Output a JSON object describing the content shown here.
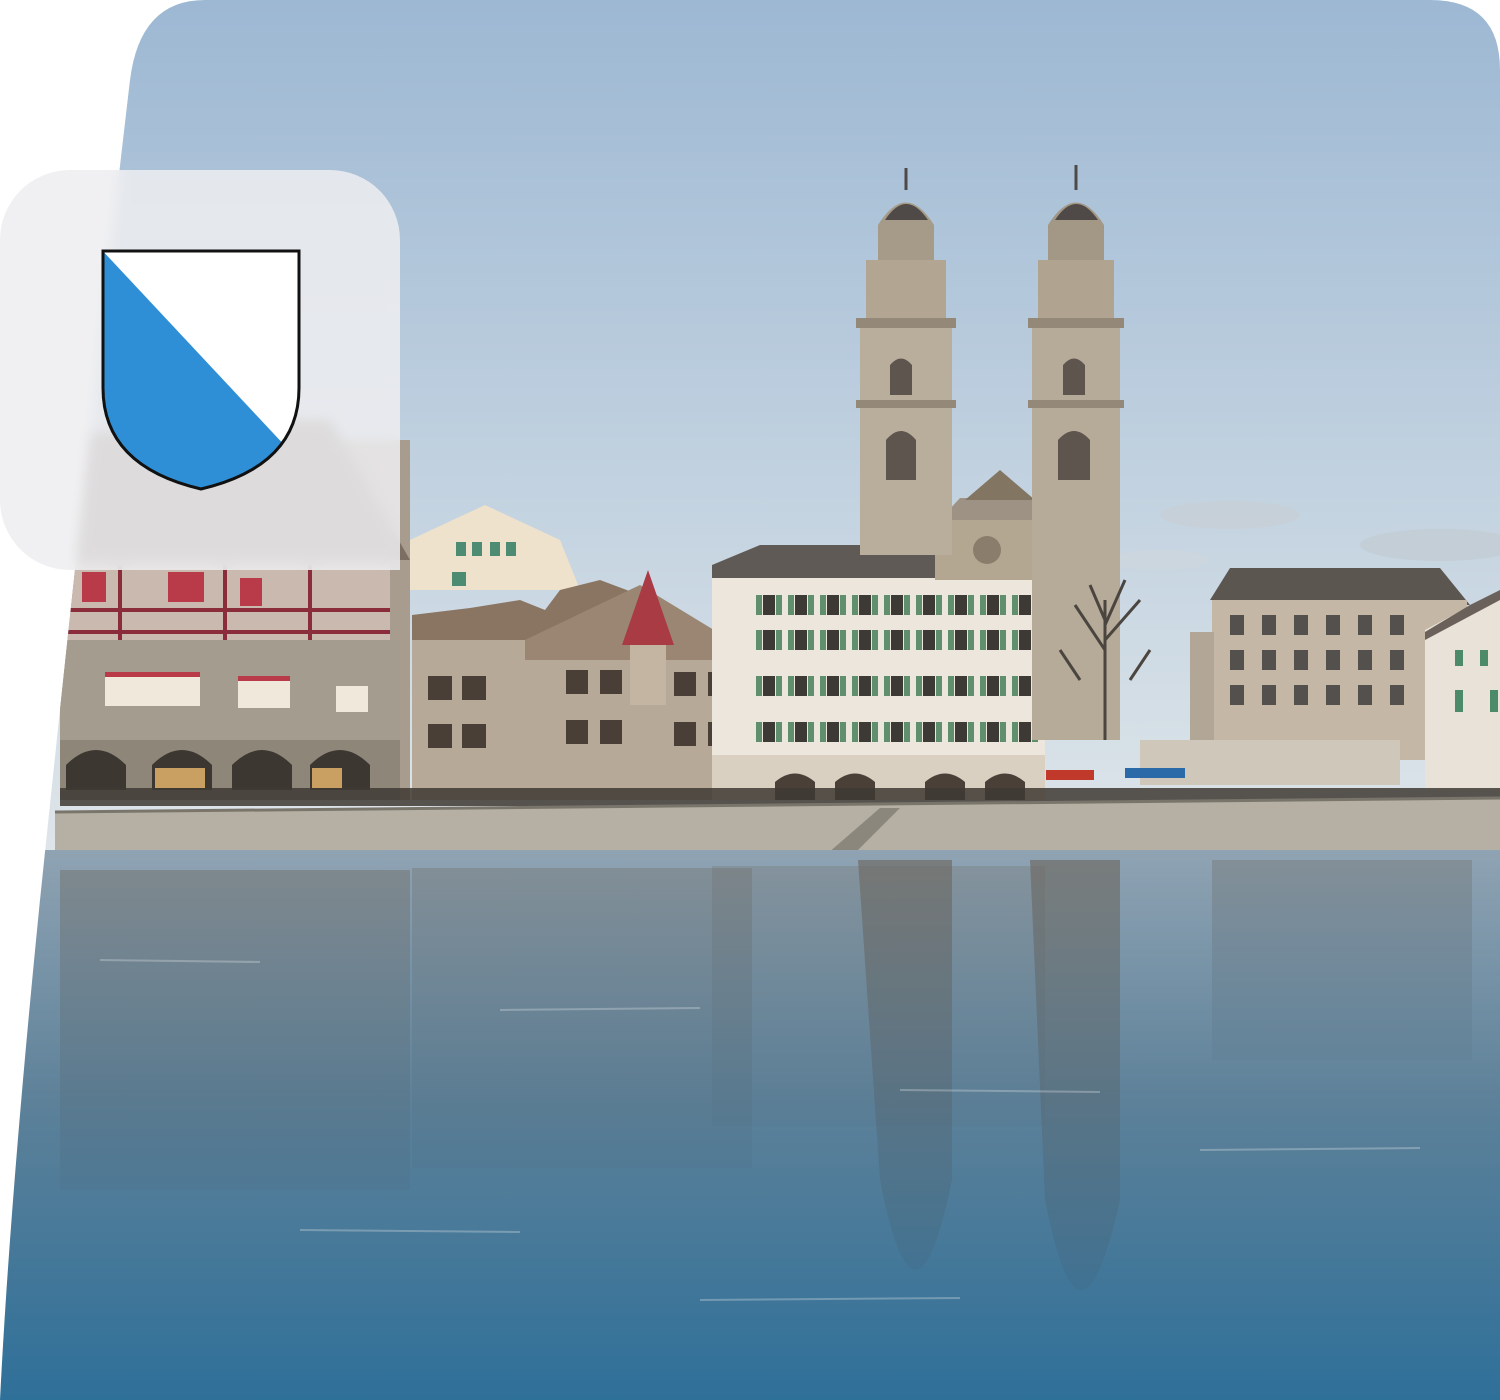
{
  "palette": {
    "sky_top": "#9db8d3",
    "sky_bottom": "#dfe6ea",
    "water_top": "#8fa3b3",
    "water_bottom": "#2d6f99",
    "stone": "#c9bfae",
    "tower": "#b9ad9c",
    "quay": "#b5b0a3",
    "badge_bg": "#eeeef0",
    "crest_blue": "#2f8fd6",
    "crest_white": "#ffffff",
    "crest_outline": "#111111",
    "window_shutter": "#5f8f6c",
    "roof_red": "#a83b44",
    "awning_red": "#c0392b",
    "awning_blue": "#2b6aa8"
  },
  "icons": {
    "crest": "zurich-coat-of-arms-icon"
  }
}
